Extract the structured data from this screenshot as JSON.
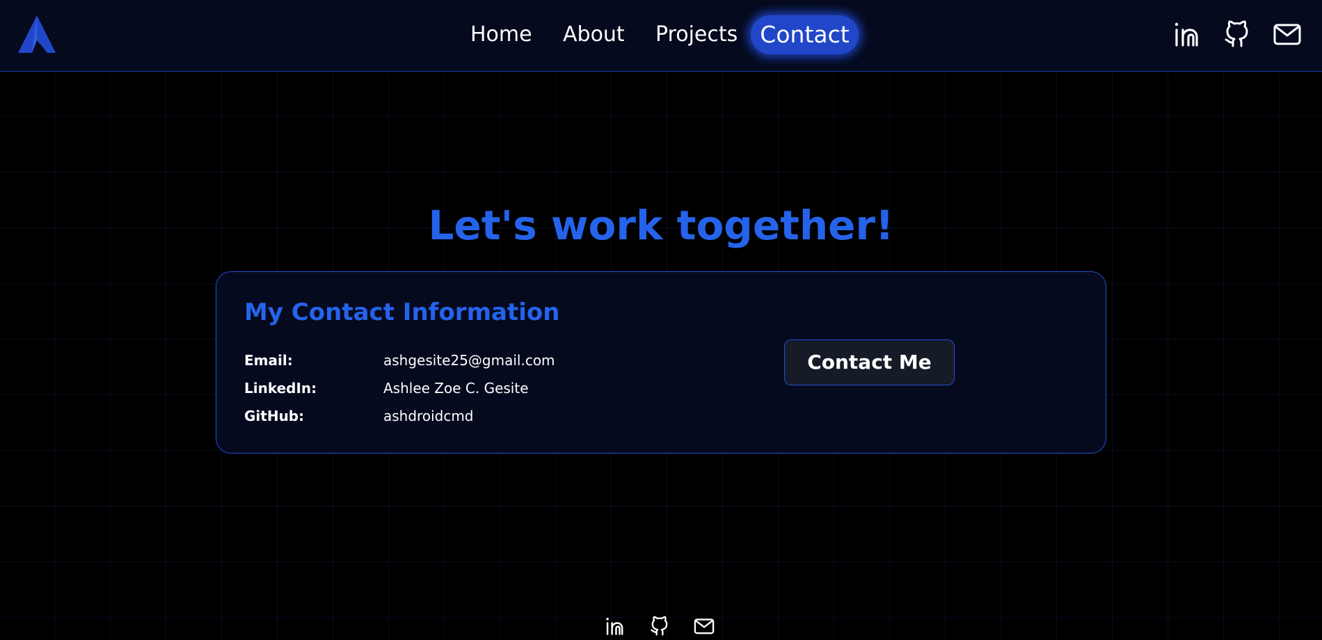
{
  "colors": {
    "accent": "#2563eb",
    "background": "#000000",
    "header_bg": "#050a1e",
    "card_bg": "#050a1e",
    "border": "#2550d8",
    "button_bg": "#161b28",
    "text": "#ffffff"
  },
  "header": {
    "logo_icon": "a-logo-icon",
    "nav": [
      {
        "label": "Home"
      },
      {
        "label": "About"
      },
      {
        "label": "Projects"
      },
      {
        "label": "Contact",
        "active": true
      }
    ],
    "icons": [
      "linkedin-icon",
      "github-icon",
      "mail-icon"
    ]
  },
  "main": {
    "headline": "Let's work together!",
    "card": {
      "title": "My Contact Information",
      "rows": [
        {
          "label": "Email:",
          "value": "ashgesite25@gmail.com"
        },
        {
          "label": "LinkedIn:",
          "value": "Ashlee Zoe C. Gesite"
        },
        {
          "label": "GitHub:",
          "value": "ashdroidcmd"
        }
      ],
      "button_label": "Contact Me"
    }
  },
  "footer": {
    "icons": [
      "linkedin-icon",
      "github-icon",
      "mail-icon"
    ]
  }
}
